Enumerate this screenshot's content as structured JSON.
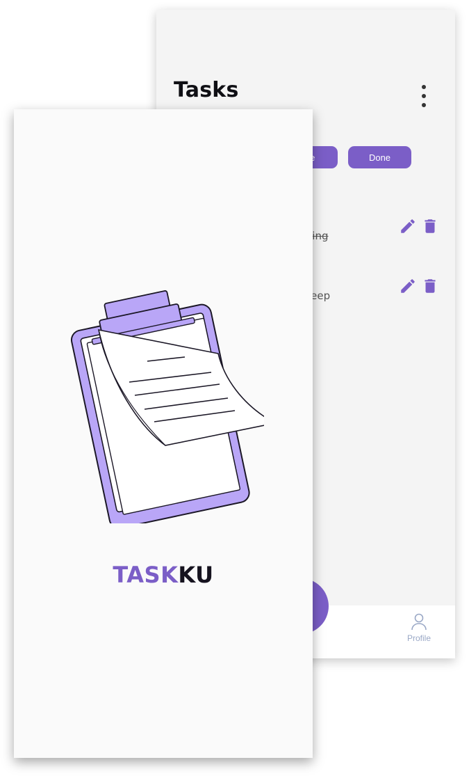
{
  "tasks_screen": {
    "title": "Tasks",
    "menu_icon": "more-vertical-icon",
    "filters": {
      "undone_label": "one",
      "done_label": "Done"
    },
    "tasks": [
      {
        "text": "eating",
        "completed": true
      },
      {
        "text": "leep",
        "completed": false
      }
    ],
    "task_actions": {
      "edit_icon": "pencil-icon",
      "delete_icon": "trash-icon"
    },
    "bottom_nav": {
      "profile_label": "Profile",
      "profile_icon": "person-icon"
    }
  },
  "splash_screen": {
    "illustration": "clipboard-illustration",
    "brand_part1": "TASK",
    "brand_part2": "KU"
  },
  "colors": {
    "accent": "#7b5ec7",
    "accent_light": "#b9a6f7",
    "dark": "#16131f",
    "nav_label": "#9aa8c6"
  }
}
